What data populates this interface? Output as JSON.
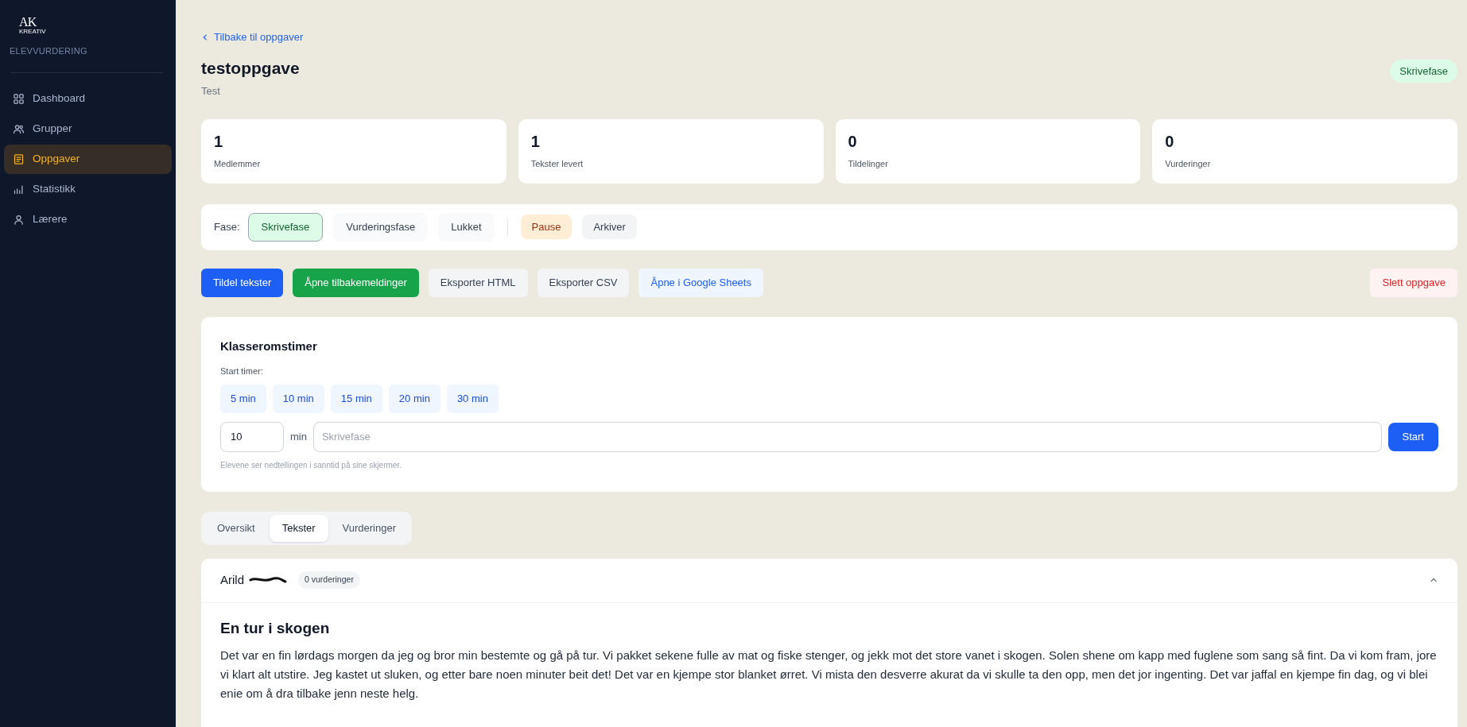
{
  "sidebar": {
    "logo": {
      "mark": "AK",
      "sub": "KREATIV"
    },
    "app_name": "ELEVVURDERING",
    "items": [
      {
        "label": "Dashboard",
        "kind": "grid",
        "selected": false
      },
      {
        "label": "Grupper",
        "kind": "users",
        "selected": false
      },
      {
        "label": "Oppgaver",
        "kind": "document",
        "selected": true
      },
      {
        "label": "Statistikk",
        "kind": "bars",
        "selected": false
      },
      {
        "label": "Lærere",
        "kind": "user",
        "selected": false
      }
    ]
  },
  "back_link": "Tilbake til oppgaver",
  "title": "testoppgave",
  "subtitle": "Test",
  "status_badge": "Skrivefase",
  "stats": [
    {
      "value": "1",
      "label": "Medlemmer"
    },
    {
      "value": "1",
      "label": "Tekster levert"
    },
    {
      "value": "0",
      "label": "Tildelinger"
    },
    {
      "value": "0",
      "label": "Vurderinger"
    }
  ],
  "phase": {
    "label": "Fase:",
    "options": [
      {
        "label": "Skrivefase",
        "selected": true
      },
      {
        "label": "Vurderingsfase",
        "selected": false
      },
      {
        "label": "Lukket",
        "selected": false
      }
    ],
    "actions": [
      {
        "label": "Pause",
        "kind": "warning"
      },
      {
        "label": "Arkiver",
        "kind": "neutral"
      }
    ]
  },
  "actions": [
    {
      "label": "Tildel tekster",
      "kind": "primary"
    },
    {
      "label": "Åpne tilbakemeldinger",
      "kind": "success"
    },
    {
      "label": "Eksporter HTML",
      "kind": "neutral"
    },
    {
      "label": "Eksporter CSV",
      "kind": "neutral"
    },
    {
      "label": "Åpne i Google Sheets",
      "kind": "link"
    },
    {
      "label": "Slett oppgave",
      "kind": "danger"
    }
  ],
  "timer": {
    "title": "Klasseromstimer",
    "start_label": "Start timer:",
    "presets": [
      "5 min",
      "10 min",
      "15 min",
      "20 min",
      "30 min"
    ],
    "minutes": "10",
    "unit": "min",
    "phase_placeholder": "Skrivefase",
    "start_button": "Start",
    "hint": "Elevene ser nedtellingen i sanntid på sine skjermer."
  },
  "tabs": [
    {
      "label": "Oversikt",
      "selected": false
    },
    {
      "label": "Tekster",
      "selected": true
    },
    {
      "label": "Vurderinger",
      "selected": false
    }
  ],
  "texts": [
    {
      "author": "Arild",
      "badge": "0 vurderinger",
      "expanded": true,
      "title": "En tur i skogen",
      "body": "Det var en fin lørdags morgen da jeg og bror min bestemte og gå på tur. Vi pakket sekene fulle av mat og fiske stenger, og jekk mot det store vanet i skogen. Solen shene om kapp med fuglene som sang så fint. Da vi kom fram, jore vi klart alt utstire. Jeg kastet ut sluken, og etter bare noen minuter beit det! Det var en kjempe stor blanket ørret. Vi mista den desverre akurat da vi skulle ta den opp, men det jor ingenting. Det var jaffal en kjempe fin dag, og vi blei enie om å dra tilbake jenn neste helg."
    }
  ]
}
